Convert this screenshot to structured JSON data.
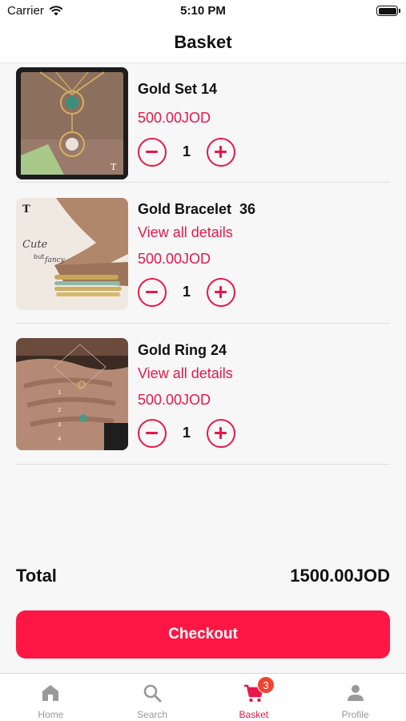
{
  "status_bar": {
    "carrier": "Carrier",
    "time": "5:10 PM"
  },
  "header": {
    "title": "Basket"
  },
  "cart": {
    "items": [
      {
        "name": "Gold Set 14",
        "link": "",
        "price": "500.00JOD",
        "quantity": "1"
      },
      {
        "name": "Gold Bracelet  36",
        "link": "View all details",
        "price": "500.00JOD",
        "quantity": "1"
      },
      {
        "name": "Gold Ring 24",
        "link": "View all details",
        "price": "500.00JOD",
        "quantity": "1"
      }
    ]
  },
  "summary": {
    "total_label": "Total",
    "total_value": "1500.00JOD"
  },
  "checkout": {
    "label": "Checkout"
  },
  "tab_bar": {
    "tabs": [
      {
        "label": "Home",
        "icon": "home-icon"
      },
      {
        "label": "Search",
        "icon": "search-icon"
      },
      {
        "label": "Basket",
        "icon": "cart-icon"
      },
      {
        "label": "Profile",
        "icon": "person-icon"
      }
    ],
    "basket_badge": "3",
    "active_color": "#e8184a",
    "inactive_color": "#999999"
  },
  "colors": {
    "accent": "#e8184a",
    "checkout": "#fe1744",
    "badge": "#f04332"
  }
}
